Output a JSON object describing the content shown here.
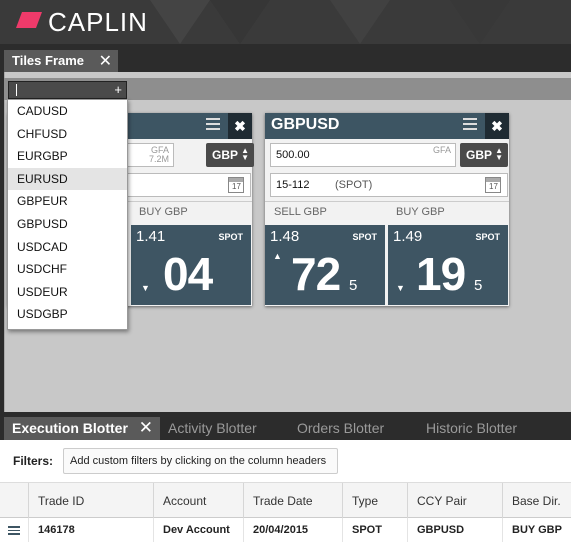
{
  "app": {
    "brand": "CAPLIN",
    "brand_color": "#ee3a6a"
  },
  "tiles_frame": {
    "tab_label": "Tiles Frame",
    "close_glyph": "✕"
  },
  "pair_picker": {
    "input_value": "",
    "add_glyph": "+",
    "items": [
      "CADUSD",
      "CHFUSD",
      "EURGBP",
      "EURUSD",
      "GBPEUR",
      "GBPUSD",
      "USDCAD",
      "USDCHF",
      "USDEUR",
      "USDGBP"
    ],
    "selected": "EURUSD"
  },
  "tile_left": {
    "gfa_line1": "GFA",
    "gfa_line2": "7.2M",
    "ccy": "GBP",
    "buy_label": "BUY GBP",
    "buy_big": "1.41",
    "buy_spot": "SPOT",
    "buy_pips": "04"
  },
  "tile_right": {
    "title": "GBPUSD",
    "close_glyph": "✖",
    "amount": "500.00",
    "gfa": "GFA",
    "ccy": "GBP",
    "tenor": "15-112",
    "tenor_spot": "(SPOT)",
    "calendar_day": "17",
    "sell_label": "SELL GBP",
    "buy_label": "BUY GBP",
    "sell": {
      "big": "1.48",
      "spot": "SPOT",
      "pips": "72",
      "frac": "5",
      "direction": "up"
    },
    "buy": {
      "big": "1.49",
      "spot": "SPOT",
      "pips": "19",
      "frac": "5",
      "direction": "down"
    }
  },
  "blotter": {
    "tabs": [
      {
        "label": "Execution Blotter",
        "active": true
      },
      {
        "label": "Activity Blotter",
        "active": false
      },
      {
        "label": "Orders Blotter",
        "active": false
      },
      {
        "label": "Historic Blotter",
        "active": false
      }
    ],
    "close_glyph": "✕",
    "filters_label": "Filters:",
    "filters_hint": "Add custom filters by clicking on the column headers",
    "columns": [
      "Trade ID",
      "Account",
      "Trade Date",
      "Type",
      "CCY Pair",
      "Base Dir."
    ],
    "rows": [
      [
        "146178",
        "Dev Account",
        "20/04/2015",
        "SPOT",
        "GBPUSD",
        "BUY GBP"
      ]
    ]
  }
}
